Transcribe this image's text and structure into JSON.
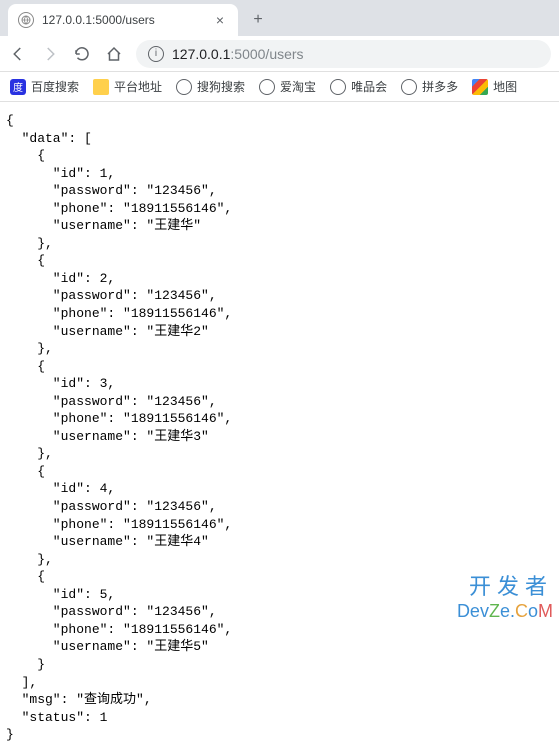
{
  "tab": {
    "title": "127.0.0.1:5000/users",
    "close": "×",
    "new_tab": "+"
  },
  "address": {
    "host": "127.0.0.1",
    "port_path": ":5000/users"
  },
  "bookmarks": {
    "baidu": "百度搜索",
    "platform": "平台地址",
    "sogou": "搜狗搜索",
    "aitaobao": "爱淘宝",
    "vip": "唯品会",
    "pdd": "拼多多",
    "maps": "地图"
  },
  "response": {
    "data": [
      {
        "id": 1,
        "password": "123456",
        "phone": "18911556146",
        "username": "王建华"
      },
      {
        "id": 2,
        "password": "123456",
        "phone": "18911556146",
        "username": "王建华2"
      },
      {
        "id": 3,
        "password": "123456",
        "phone": "18911556146",
        "username": "王建华3"
      },
      {
        "id": 4,
        "password": "123456",
        "phone": "18911556146",
        "username": "王建华4"
      },
      {
        "id": 5,
        "password": "123456",
        "phone": "18911556146",
        "username": "王建华5"
      }
    ],
    "msg": "查询成功",
    "status": 1
  },
  "watermark": {
    "line1": "开发者",
    "line2_dev": "Dev",
    "line2_z": "Z",
    "line2_e": "e",
    "line2_dot": ".",
    "line2_c": "C",
    "line2_o": "o",
    "line2_m": "M"
  }
}
